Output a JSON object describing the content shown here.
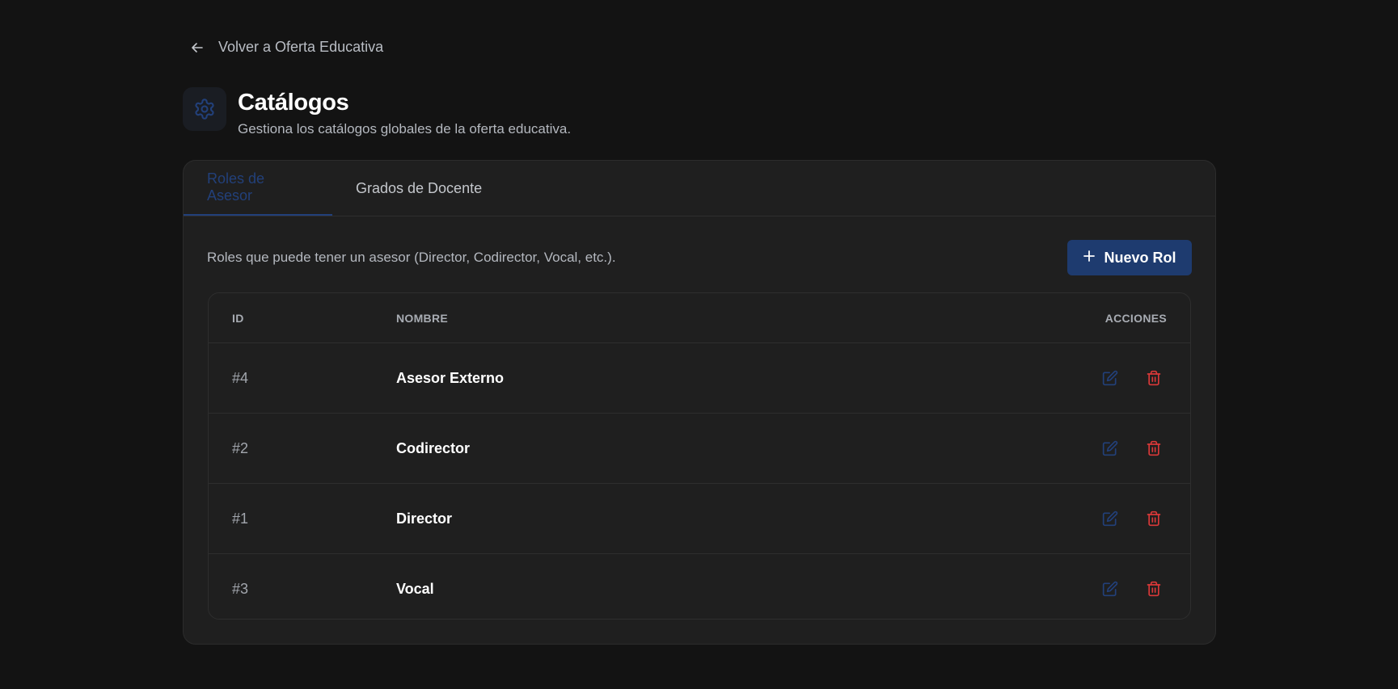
{
  "nav": {
    "back_label": "Volver a Oferta Educativa"
  },
  "header": {
    "title": "Catálogos",
    "subtitle": "Gestiona los catálogos globales de la oferta educativa.",
    "icon": "gear-icon"
  },
  "tabs": [
    {
      "label": "Roles de Asesor",
      "active": true
    },
    {
      "label": "Grados de Docente",
      "active": false
    }
  ],
  "toolbar": {
    "description": "Roles que puede tener un asesor (Director, Codirector, Vocal, etc.).",
    "new_button_label": "Nuevo Rol"
  },
  "table": {
    "columns": [
      "ID",
      "NOMBRE",
      "ACCIONES"
    ],
    "rows": [
      {
        "id": "#4",
        "name": "Asesor Externo"
      },
      {
        "id": "#2",
        "name": "Codirector"
      },
      {
        "id": "#1",
        "name": "Director"
      },
      {
        "id": "#3",
        "name": "Vocal"
      }
    ]
  },
  "colors": {
    "accent": "#22407a",
    "primary_button": "#1e3b6f",
    "danger": "#d93838",
    "background": "#131313",
    "card": "#1f1f1f"
  }
}
